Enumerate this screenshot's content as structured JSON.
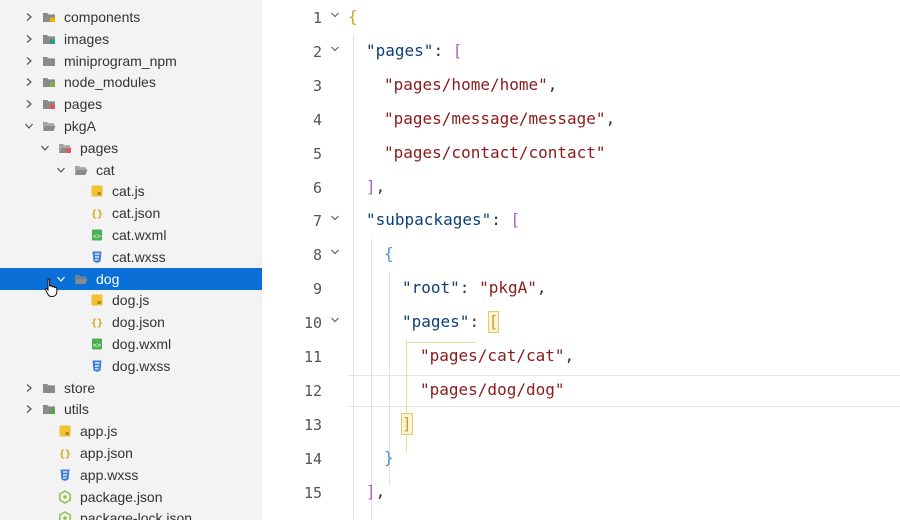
{
  "sidebar": {
    "items": [
      {
        "label": "components",
        "icon": "folder-component-icon",
        "chevron": "right",
        "indent": 0
      },
      {
        "label": "images",
        "icon": "folder-images-icon",
        "chevron": "right",
        "indent": 0
      },
      {
        "label": "miniprogram_npm",
        "icon": "folder-icon",
        "chevron": "right",
        "indent": 0
      },
      {
        "label": "node_modules",
        "icon": "folder-npm-icon",
        "chevron": "right",
        "indent": 0
      },
      {
        "label": "pages",
        "icon": "folder-pages-icon",
        "chevron": "right",
        "indent": 0
      },
      {
        "label": "pkgA",
        "icon": "folder-open-icon",
        "chevron": "down",
        "indent": 0
      },
      {
        "label": "pages",
        "icon": "folder-pages-open-icon",
        "chevron": "down",
        "indent": 1
      },
      {
        "label": "cat",
        "icon": "folder-open-icon",
        "chevron": "down",
        "indent": 2
      },
      {
        "label": "cat.js",
        "icon": "js-file-icon",
        "chevron": "none",
        "indent": 3
      },
      {
        "label": "cat.json",
        "icon": "json-file-icon",
        "chevron": "none",
        "indent": 3
      },
      {
        "label": "cat.wxml",
        "icon": "wxml-file-icon",
        "chevron": "none",
        "indent": 3
      },
      {
        "label": "cat.wxss",
        "icon": "wxss-file-icon",
        "chevron": "none",
        "indent": 3
      },
      {
        "label": "dog",
        "icon": "folder-open-icon",
        "chevron": "down",
        "indent": 2,
        "selected": true
      },
      {
        "label": "dog.js",
        "icon": "js-file-icon",
        "chevron": "none",
        "indent": 3
      },
      {
        "label": "dog.json",
        "icon": "json-file-icon",
        "chevron": "none",
        "indent": 3
      },
      {
        "label": "dog.wxml",
        "icon": "wxml-file-icon",
        "chevron": "none",
        "indent": 3
      },
      {
        "label": "dog.wxss",
        "icon": "wxss-file-icon",
        "chevron": "none",
        "indent": 3
      },
      {
        "label": "store",
        "icon": "folder-icon",
        "chevron": "right",
        "indent": 0
      },
      {
        "label": "utils",
        "icon": "folder-utils-icon",
        "chevron": "right",
        "indent": 0
      },
      {
        "label": "app.js",
        "icon": "js-file-icon",
        "chevron": "none",
        "indent": 1
      },
      {
        "label": "app.json",
        "icon": "json-file-icon",
        "chevron": "none",
        "indent": 1
      },
      {
        "label": "app.wxss",
        "icon": "wxss-file-icon",
        "chevron": "none",
        "indent": 1
      },
      {
        "label": "package.json",
        "icon": "npm-package-icon",
        "chevron": "none",
        "indent": 1
      },
      {
        "label": "package-lock.json",
        "icon": "npm-package-icon",
        "chevron": "none",
        "indent": 1
      }
    ]
  },
  "editor": {
    "lines": [
      {
        "num": "1",
        "fold": true,
        "indent": 0,
        "tokens": [
          {
            "t": "{",
            "c": "y"
          }
        ]
      },
      {
        "num": "2",
        "fold": true,
        "indent": 1,
        "tokens": [
          {
            "t": "\"pages\"",
            "c": "k"
          },
          {
            "t": ": ",
            "c": "punct"
          },
          {
            "t": "[",
            "c": "p"
          }
        ]
      },
      {
        "num": "3",
        "fold": false,
        "indent": 2,
        "tokens": [
          {
            "t": "\"pages/home/home\"",
            "c": "s"
          },
          {
            "t": ",",
            "c": "punct"
          }
        ]
      },
      {
        "num": "4",
        "fold": false,
        "indent": 2,
        "tokens": [
          {
            "t": "\"pages/message/message\"",
            "c": "s"
          },
          {
            "t": ",",
            "c": "punct"
          }
        ]
      },
      {
        "num": "5",
        "fold": false,
        "indent": 2,
        "tokens": [
          {
            "t": "\"pages/contact/contact\"",
            "c": "s"
          }
        ]
      },
      {
        "num": "6",
        "fold": false,
        "indent": 1,
        "tokens": [
          {
            "t": "]",
            "c": "p"
          },
          {
            "t": ",",
            "c": "punct"
          }
        ]
      },
      {
        "num": "7",
        "fold": true,
        "indent": 1,
        "tokens": [
          {
            "t": "\"subpackages\"",
            "c": "k"
          },
          {
            "t": ": ",
            "c": "punct"
          },
          {
            "t": "[",
            "c": "p"
          }
        ]
      },
      {
        "num": "8",
        "fold": true,
        "indent": 2,
        "tokens": [
          {
            "t": "{",
            "c": "b"
          }
        ]
      },
      {
        "num": "9",
        "fold": false,
        "indent": 3,
        "tokens": [
          {
            "t": "\"root\"",
            "c": "k"
          },
          {
            "t": ": ",
            "c": "punct"
          },
          {
            "t": "\"pkgA\"",
            "c": "s"
          },
          {
            "t": ",",
            "c": "punct"
          }
        ]
      },
      {
        "num": "10",
        "fold": true,
        "indent": 3,
        "tokens": [
          {
            "t": "\"pages\"",
            "c": "k"
          },
          {
            "t": ": ",
            "c": "punct"
          },
          {
            "t": "[",
            "c": "y",
            "match": true
          }
        ]
      },
      {
        "num": "11",
        "fold": false,
        "indent": 4,
        "tokens": [
          {
            "t": "\"pages/cat/cat\"",
            "c": "s"
          },
          {
            "t": ",",
            "c": "punct"
          }
        ]
      },
      {
        "num": "12",
        "fold": false,
        "indent": 4,
        "tokens": [
          {
            "t": "\"pages/dog/dog\"",
            "c": "s"
          }
        ]
      },
      {
        "num": "13",
        "fold": false,
        "indent": 3,
        "tokens": [
          {
            "t": "]",
            "c": "y",
            "match": true
          }
        ]
      },
      {
        "num": "14",
        "fold": false,
        "indent": 2,
        "tokens": [
          {
            "t": "}",
            "c": "b"
          }
        ]
      },
      {
        "num": "15",
        "fold": false,
        "indent": 1,
        "tokens": [
          {
            "t": "]",
            "c": "p"
          },
          {
            "t": ",",
            "c": "punct"
          }
        ]
      }
    ]
  },
  "colors": {
    "sidebar_bg": "#f3f3f3",
    "selection": "#0a6fd6",
    "json_key": "#0b3f7a",
    "json_string": "#8b1a1a",
    "bracket_yellow": "#c9a227",
    "bracket_purple": "#b05fc4",
    "bracket_blue": "#4a8fd8"
  }
}
